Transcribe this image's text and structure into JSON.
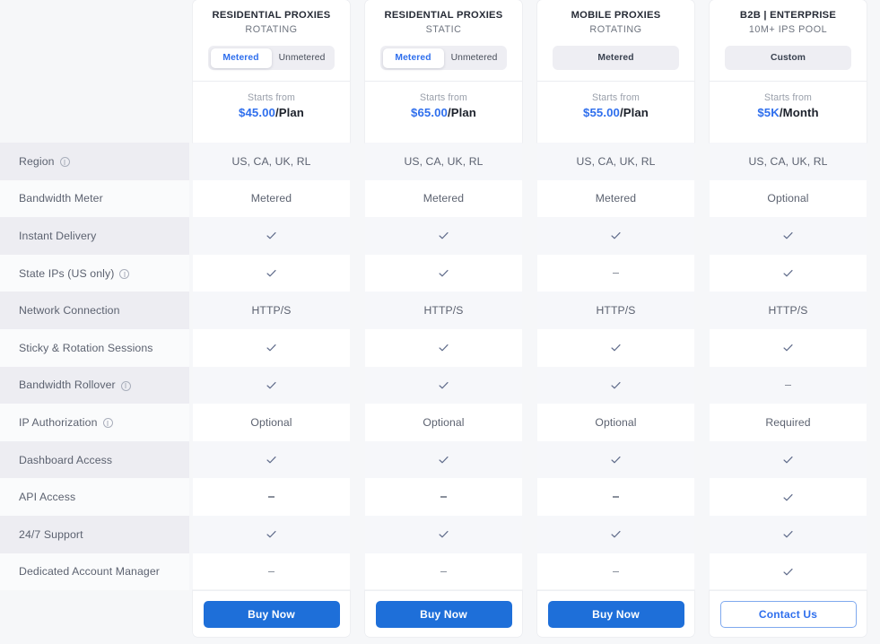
{
  "colors": {
    "accent": "#2f6fed",
    "button": "#1e6fd9",
    "row_shade": "#ededf2",
    "check": "#5f6b8a",
    "text": "#5c6270"
  },
  "plans": [
    {
      "title": "RESIDENTIAL PROXIES",
      "subtitle": "ROTATING",
      "toggle_type": "segmented",
      "options": [
        "Metered",
        "Unmetered"
      ],
      "selected": "Metered",
      "starts_from": "Starts from",
      "price_amount": "$45.00",
      "price_period": "/Plan",
      "cta": "Buy Now",
      "cta_style": "primary"
    },
    {
      "title": "RESIDENTIAL PROXIES",
      "subtitle": "STATIC",
      "toggle_type": "segmented",
      "options": [
        "Metered",
        "Unmetered"
      ],
      "selected": "Metered",
      "starts_from": "Starts from",
      "price_amount": "$65.00",
      "price_period": "/Plan",
      "cta": "Buy Now",
      "cta_style": "primary"
    },
    {
      "title": "MOBILE PROXIES",
      "subtitle": "ROTATING",
      "toggle_type": "single",
      "options": [
        "Metered"
      ],
      "selected": "Metered",
      "starts_from": "Starts from",
      "price_amount": "$55.00",
      "price_period": "/Plan",
      "cta": "Buy Now",
      "cta_style": "primary"
    },
    {
      "title": "B2B | ENTERPRISE",
      "subtitle": "10M+ IPS POOL",
      "toggle_type": "single",
      "options": [
        "Custom"
      ],
      "selected": "Custom",
      "starts_from": "Starts from",
      "price_amount": "$5K",
      "price_period": "/Month",
      "cta": "Contact Us",
      "cta_style": "outline"
    }
  ],
  "features": [
    {
      "label": "Region",
      "info": true,
      "values": [
        "US, CA, UK, RL",
        "US, CA, UK, RL",
        "US, CA, UK, RL",
        "US, CA, UK, RL"
      ]
    },
    {
      "label": "Bandwidth Meter",
      "info": false,
      "values": [
        "Metered",
        "Metered",
        "Metered",
        "Optional"
      ]
    },
    {
      "label": "Instant Delivery",
      "info": false,
      "values": [
        "check",
        "check",
        "check",
        "check"
      ]
    },
    {
      "label": "State IPs (US only)",
      "info": true,
      "values": [
        "check",
        "check",
        "dash",
        "check"
      ]
    },
    {
      "label": "Network Connection",
      "info": false,
      "values": [
        "HTTP/S",
        "HTTP/S",
        "HTTP/S",
        "HTTP/S"
      ]
    },
    {
      "label": "Sticky & Rotation Sessions",
      "info": false,
      "values": [
        "check",
        "check",
        "check",
        "check"
      ]
    },
    {
      "label": "Bandwidth Rollover",
      "info": true,
      "values": [
        "check",
        "check",
        "check",
        "dash"
      ]
    },
    {
      "label": "IP Authorization",
      "info": true,
      "values": [
        "Optional",
        "Optional",
        "Optional",
        "Required"
      ]
    },
    {
      "label": "Dashboard Access",
      "info": false,
      "values": [
        "check",
        "check",
        "check",
        "check"
      ]
    },
    {
      "label": "API Access",
      "info": false,
      "values": [
        "dash",
        "dash",
        "dash",
        "check"
      ]
    },
    {
      "label": "24/7 Support",
      "info": false,
      "values": [
        "check",
        "check",
        "check",
        "check"
      ]
    },
    {
      "label": "Dedicated Account Manager",
      "info": false,
      "values": [
        "dash",
        "dash",
        "dash",
        "check"
      ]
    }
  ]
}
